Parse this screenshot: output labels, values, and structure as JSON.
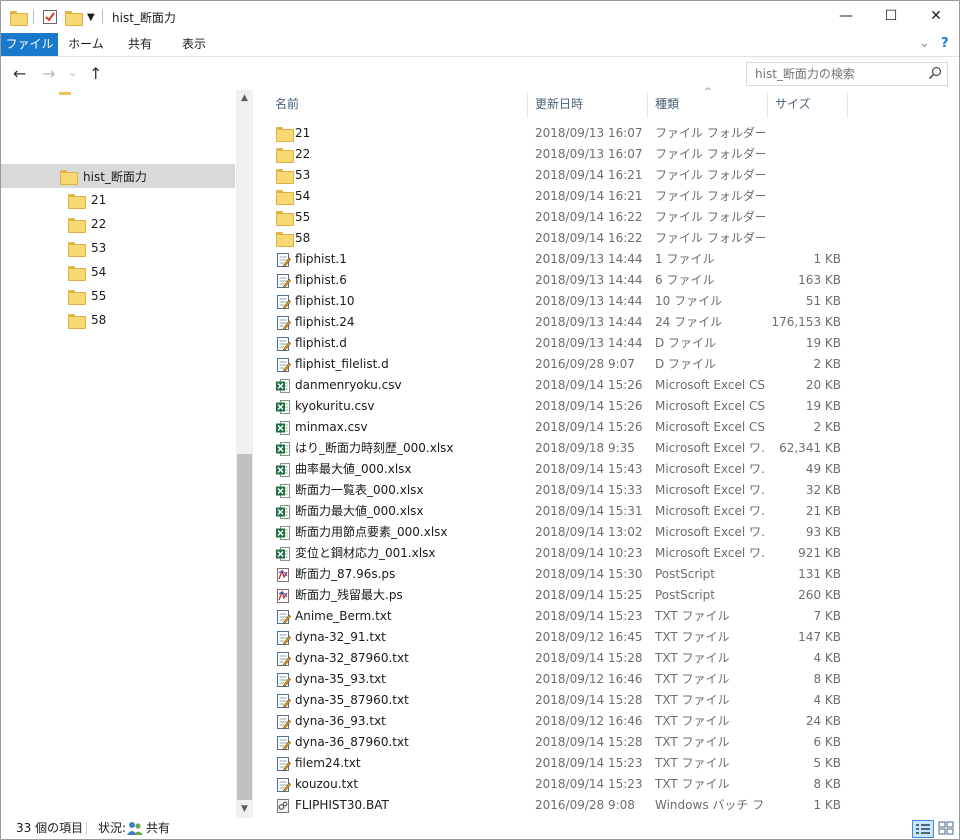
{
  "window": {
    "title": "hist_断面力",
    "minimize_glyph": "—",
    "maximize_glyph": "☐",
    "close_glyph": "✕"
  },
  "ribbon": {
    "tabs": [
      "ファイル",
      "ホーム",
      "共有",
      "表示"
    ],
    "expand_glyph": "⌄",
    "help_glyph": "?"
  },
  "nav": {
    "back_glyph": "←",
    "forward_glyph": "→",
    "recent_glyph": "⌄",
    "up_glyph": "↑",
    "search_placeholder": "hist_断面力の検索"
  },
  "tree": {
    "selected": "hist_断面力",
    "children": [
      "21",
      "22",
      "53",
      "54",
      "55",
      "58"
    ]
  },
  "columns": {
    "name": "名前",
    "date": "更新日時",
    "type": "種類",
    "size": "サイズ",
    "sort_glyph": "^"
  },
  "files": [
    {
      "name": "21",
      "date": "2018/09/13 16:07",
      "type": "ファイル フォルダー",
      "size": "",
      "icon": "folder-icon"
    },
    {
      "name": "22",
      "date": "2018/09/13 16:07",
      "type": "ファイル フォルダー",
      "size": "",
      "icon": "folder-icon"
    },
    {
      "name": "53",
      "date": "2018/09/14 16:21",
      "type": "ファイル フォルダー",
      "size": "",
      "icon": "folder-icon"
    },
    {
      "name": "54",
      "date": "2018/09/14 16:21",
      "type": "ファイル フォルダー",
      "size": "",
      "icon": "folder-icon"
    },
    {
      "name": "55",
      "date": "2018/09/14 16:22",
      "type": "ファイル フォルダー",
      "size": "",
      "icon": "folder-icon"
    },
    {
      "name": "58",
      "date": "2018/09/14 16:22",
      "type": "ファイル フォルダー",
      "size": "",
      "icon": "folder-icon"
    },
    {
      "name": "fliphist.1",
      "date": "2018/09/13 14:44",
      "type": "1 ファイル",
      "size": "1 KB",
      "icon": "text-file-icon"
    },
    {
      "name": "fliphist.6",
      "date": "2018/09/13 14:44",
      "type": "6 ファイル",
      "size": "163 KB",
      "icon": "text-file-icon"
    },
    {
      "name": "fliphist.10",
      "date": "2018/09/13 14:44",
      "type": "10 ファイル",
      "size": "51 KB",
      "icon": "text-file-icon"
    },
    {
      "name": "fliphist.24",
      "date": "2018/09/13 14:44",
      "type": "24 ファイル",
      "size": "176,153 KB",
      "icon": "text-file-icon"
    },
    {
      "name": "fliphist.d",
      "date": "2018/09/13 14:44",
      "type": "D ファイル",
      "size": "19 KB",
      "icon": "text-file-icon"
    },
    {
      "name": "fliphist_filelist.d",
      "date": "2016/09/28 9:07",
      "type": "D ファイル",
      "size": "2 KB",
      "icon": "text-file-icon"
    },
    {
      "name": "danmenryoku.csv",
      "date": "2018/09/14 15:26",
      "type": "Microsoft Excel CS...",
      "size": "20 KB",
      "icon": "excel-icon"
    },
    {
      "name": "kyokuritu.csv",
      "date": "2018/09/14 15:26",
      "type": "Microsoft Excel CS...",
      "size": "19 KB",
      "icon": "excel-icon"
    },
    {
      "name": "minmax.csv",
      "date": "2018/09/14 15:26",
      "type": "Microsoft Excel CS...",
      "size": "2 KB",
      "icon": "excel-icon"
    },
    {
      "name": "はり_断面力時刻歴_000.xlsx",
      "date": "2018/09/18 9:35",
      "type": "Microsoft Excel ワ...",
      "size": "62,341 KB",
      "icon": "excel-icon"
    },
    {
      "name": "曲率最大値_000.xlsx",
      "date": "2018/09/14 15:43",
      "type": "Microsoft Excel ワ...",
      "size": "49 KB",
      "icon": "excel-icon"
    },
    {
      "name": "断面力一覧表_000.xlsx",
      "date": "2018/09/14 15:33",
      "type": "Microsoft Excel ワ...",
      "size": "32 KB",
      "icon": "excel-icon"
    },
    {
      "name": "断面力最大値_000.xlsx",
      "date": "2018/09/14 15:31",
      "type": "Microsoft Excel ワ...",
      "size": "21 KB",
      "icon": "excel-icon"
    },
    {
      "name": "断面力用節点要素_000.xlsx",
      "date": "2018/09/14 13:02",
      "type": "Microsoft Excel ワ...",
      "size": "93 KB",
      "icon": "excel-icon"
    },
    {
      "name": "変位と鋼材応力_001.xlsx",
      "date": "2018/09/14 10:23",
      "type": "Microsoft Excel ワ...",
      "size": "921 KB",
      "icon": "excel-icon"
    },
    {
      "name": "断面力_87.96s.ps",
      "date": "2018/09/14 15:30",
      "type": "PostScript",
      "size": "131 KB",
      "icon": "postscript-icon"
    },
    {
      "name": "断面力_残留最大.ps",
      "date": "2018/09/14 15:25",
      "type": "PostScript",
      "size": "260 KB",
      "icon": "postscript-icon"
    },
    {
      "name": "Anime_Berm.txt",
      "date": "2018/09/14 15:23",
      "type": "TXT ファイル",
      "size": "7 KB",
      "icon": "text-file-icon"
    },
    {
      "name": "dyna-32_91.txt",
      "date": "2018/09/12 16:45",
      "type": "TXT ファイル",
      "size": "147 KB",
      "icon": "text-file-icon"
    },
    {
      "name": "dyna-32_87960.txt",
      "date": "2018/09/14 15:28",
      "type": "TXT ファイル",
      "size": "4 KB",
      "icon": "text-file-icon"
    },
    {
      "name": "dyna-35_93.txt",
      "date": "2018/09/12 16:46",
      "type": "TXT ファイル",
      "size": "8 KB",
      "icon": "text-file-icon"
    },
    {
      "name": "dyna-35_87960.txt",
      "date": "2018/09/14 15:28",
      "type": "TXT ファイル",
      "size": "4 KB",
      "icon": "text-file-icon"
    },
    {
      "name": "dyna-36_93.txt",
      "date": "2018/09/12 16:46",
      "type": "TXT ファイル",
      "size": "24 KB",
      "icon": "text-file-icon"
    },
    {
      "name": "dyna-36_87960.txt",
      "date": "2018/09/14 15:28",
      "type": "TXT ファイル",
      "size": "6 KB",
      "icon": "text-file-icon"
    },
    {
      "name": "filem24.txt",
      "date": "2018/09/14 15:23",
      "type": "TXT ファイル",
      "size": "5 KB",
      "icon": "text-file-icon"
    },
    {
      "name": "kouzou.txt",
      "date": "2018/09/14 15:23",
      "type": "TXT ファイル",
      "size": "8 KB",
      "icon": "text-file-icon"
    },
    {
      "name": "FLIPHIST30.BAT",
      "date": "2016/09/28 9:08",
      "type": "Windows バッチ ファ",
      "size": "1 KB",
      "icon": "batch-file-icon"
    }
  ],
  "status": {
    "item_count": "33 個の項目",
    "state_label": "状況:",
    "state_value": "共有"
  },
  "colors": {
    "accent": "#1979ca",
    "folder": "#f8d775",
    "excel": "#1e7145",
    "selection": "#d9d9d9"
  }
}
